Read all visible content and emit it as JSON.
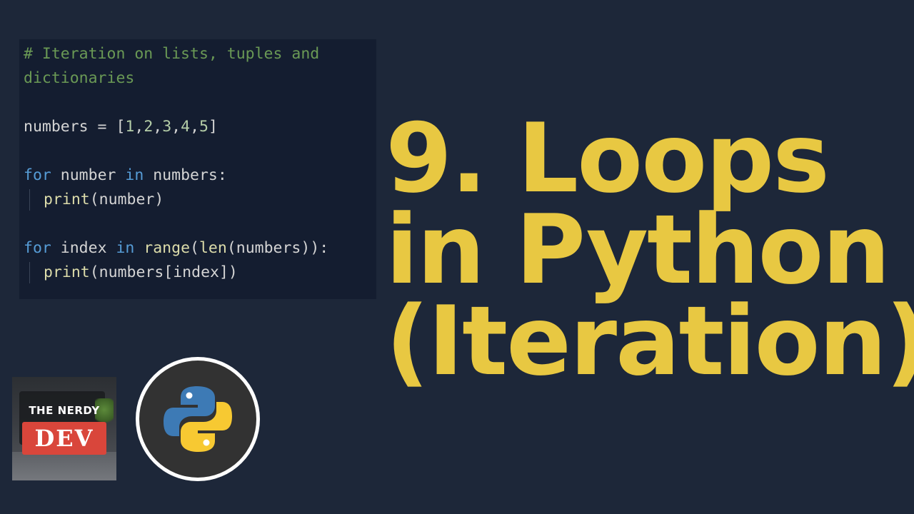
{
  "code": {
    "comment_line1": "# Iteration on lists, tuples and",
    "comment_line2": "dictionaries",
    "line_numbers_var": "numbers",
    "line_numbers_assign": " = ",
    "line_numbers_open": "[",
    "n1": "1",
    "c1": ",",
    "n2": "2",
    "c2": ",",
    "n3": "3",
    "c3": ",",
    "n4": "4",
    "c4": ",",
    "n5": "5",
    "line_numbers_close": "]",
    "loop1_for": "for",
    "loop1_var": " number ",
    "loop1_in": "in",
    "loop1_iter": " numbers:",
    "loop1_print": "print",
    "loop1_args": "(number)",
    "loop2_for": "for",
    "loop2_var": " index ",
    "loop2_in": "in",
    "loop2_sp": " ",
    "loop2_range": "range",
    "loop2_paren": "(",
    "loop2_len": "len",
    "loop2_rest": "(numbers)):",
    "loop2_print": "print",
    "loop2_args": "(numbers[index])"
  },
  "title": {
    "line1": "9. Loops",
    "line2": "in Python",
    "line3": "(Iteration)"
  },
  "logo": {
    "line1": "THE NERDY",
    "line2": "DEV"
  },
  "icons": {
    "python": "python-logo-icon"
  },
  "colors": {
    "background": "#1d2739",
    "title": "#e8c842",
    "python_blue": "#3d7ab5",
    "python_yellow": "#f7c932"
  }
}
